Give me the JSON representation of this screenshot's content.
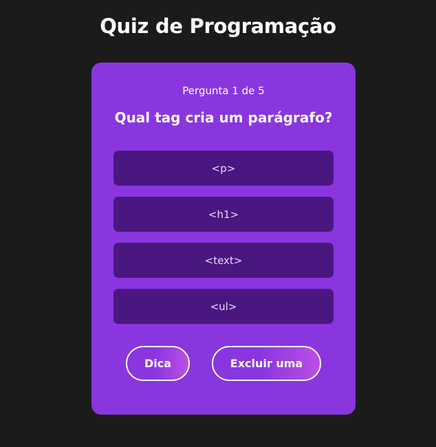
{
  "header": {
    "title": "Quiz de Programação"
  },
  "quiz": {
    "counter": "Pergunta 1 de 5",
    "question": "Qual tag cria um parágrafo?",
    "options": [
      {
        "label": "<p>"
      },
      {
        "label": "<h1>"
      },
      {
        "label": "<text>"
      },
      {
        "label": "<ul>"
      }
    ]
  },
  "actions": {
    "hint_label": "Dica",
    "remove_label": "Excluir uma"
  },
  "colors": {
    "background": "#1b1b1b",
    "card": "#8a36df",
    "option": "#4a1780",
    "text": "#ffffff"
  }
}
